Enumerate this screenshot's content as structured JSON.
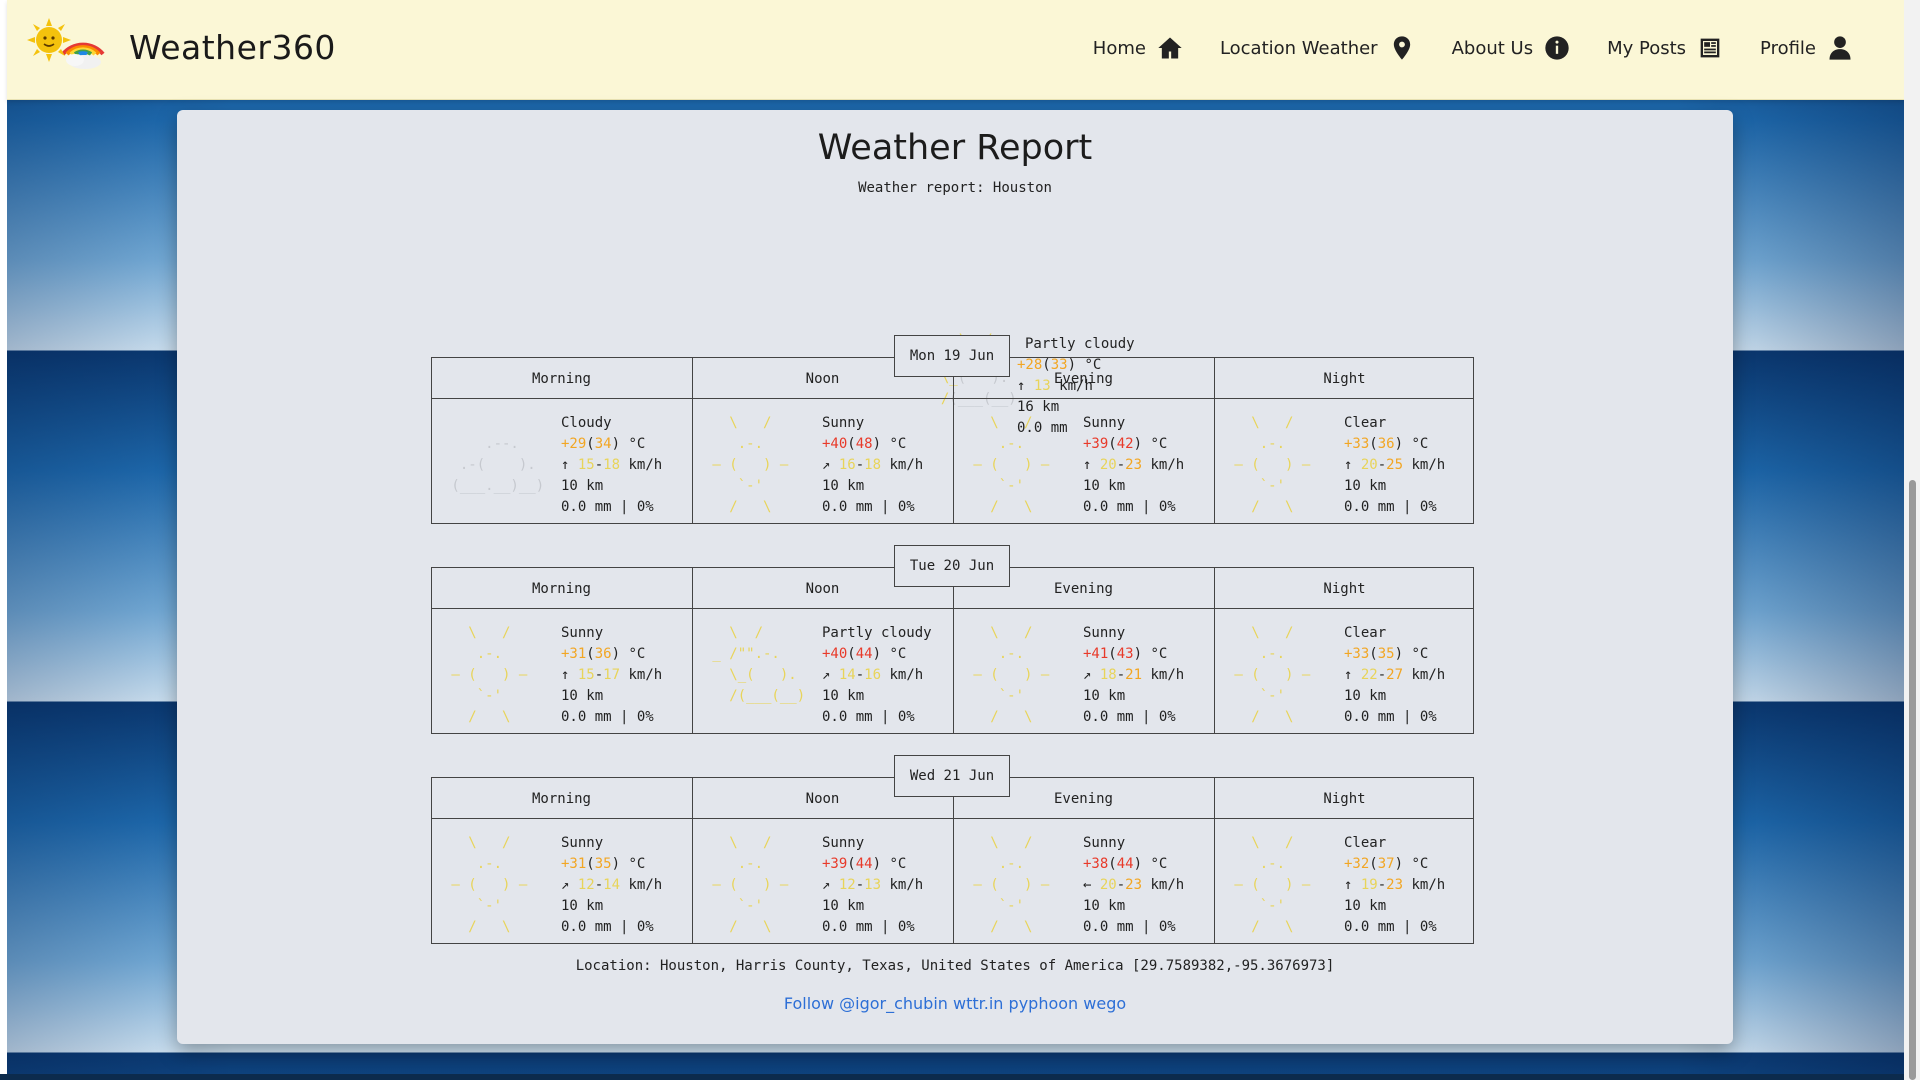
{
  "app": {
    "brand": "Weather360"
  },
  "nav": {
    "home": "Home",
    "location_weather": "Location Weather",
    "about_us": "About Us",
    "my_posts": "My Posts",
    "profile": "Profile"
  },
  "report": {
    "title": "Weather Report",
    "subtitle": "Weather report: Houston",
    "current": {
      "condition": "Partly cloudy",
      "temp": "+28",
      "feels": "33",
      "temp_unit": " °C",
      "wind_arrow": "↑",
      "wind": "13",
      "wind_unit": " km/h",
      "visibility": "16 km",
      "precip": "0.0 mm"
    },
    "periods": [
      "Morning",
      "Noon",
      "Evening",
      "Night"
    ],
    "days": [
      {
        "label": "Mon 19 Jun",
        "cells": [
          {
            "cond": "Cloudy",
            "t1": "+29",
            "t2": "34",
            "warr": "↑",
            "w1": "15",
            "w2": "18",
            "vis": "10 km",
            "prec": "0.0 mm | 0%"
          },
          {
            "cond": "Sunny",
            "t1": "+40",
            "t2": "48",
            "warr": "↗",
            "w1": "16",
            "w2": "18",
            "vis": "10 km",
            "prec": "0.0 mm | 0%"
          },
          {
            "cond": "Sunny",
            "t1": "+39",
            "t2": "42",
            "warr": "↑",
            "w1": "20",
            "w2": "23",
            "vis": "10 km",
            "prec": "0.0 mm | 0%"
          },
          {
            "cond": "Clear",
            "t1": "+33",
            "t2": "36",
            "warr": "↑",
            "w1": "20",
            "w2": "25",
            "vis": "10 km",
            "prec": "0.0 mm | 0%"
          }
        ]
      },
      {
        "label": "Tue 20 Jun",
        "cells": [
          {
            "cond": "Sunny",
            "t1": "+31",
            "t2": "36",
            "warr": "↑",
            "w1": "15",
            "w2": "17",
            "vis": "10 km",
            "prec": "0.0 mm | 0%"
          },
          {
            "cond": "Partly cloudy",
            "t1": "+40",
            "t2": "44",
            "warr": "↗",
            "w1": "14",
            "w2": "16",
            "vis": "10 km",
            "prec": "0.0 mm | 0%"
          },
          {
            "cond": "Sunny",
            "t1": "+41",
            "t2": "43",
            "warr": "↗",
            "w1": "18",
            "w2": "21",
            "vis": "10 km",
            "prec": "0.0 mm | 0%"
          },
          {
            "cond": "Clear",
            "t1": "+33",
            "t2": "35",
            "warr": "↑",
            "w1": "22",
            "w2": "27",
            "vis": "10 km",
            "prec": "0.0 mm | 0%"
          }
        ]
      },
      {
        "label": "Wed 21 Jun",
        "cells": [
          {
            "cond": "Sunny",
            "t1": "+31",
            "t2": "35",
            "warr": "↗",
            "w1": "12",
            "w2": "14",
            "vis": "10 km",
            "prec": "0.0 mm | 0%"
          },
          {
            "cond": "Sunny",
            "t1": "+39",
            "t2": "44",
            "warr": "↗",
            "w1": "12",
            "w2": "13",
            "vis": "10 km",
            "prec": "0.0 mm | 0%"
          },
          {
            "cond": "Sunny",
            "t1": "+38",
            "t2": "44",
            "warr": "←",
            "w1": "20",
            "w2": "23",
            "vis": "10 km",
            "prec": "0.0 mm | 0%"
          },
          {
            "cond": "Clear",
            "t1": "+32",
            "t2": "37",
            "warr": "↑",
            "w1": "19",
            "w2": "23",
            "vis": "10 km",
            "prec": "0.0 mm | 0%"
          }
        ]
      }
    ],
    "location": "Location: Houston, Harris County, Texas, United States of America [29.7589382,-95.3676973]",
    "follow": {
      "prefix": "Follow ",
      "handle": "@igor_chubin",
      "sep1": " ",
      "wttr": "wttr.in",
      "sep2": " ",
      "pyphoon": "pyphoon",
      "sep3": " ",
      "wego": "wego"
    }
  }
}
